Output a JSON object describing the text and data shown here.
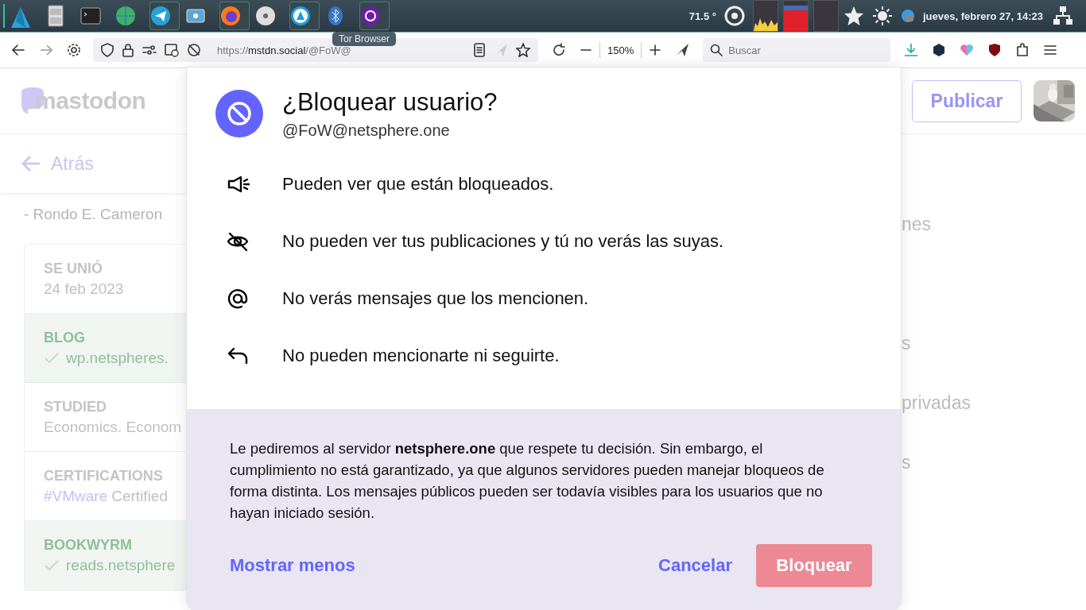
{
  "taskbar": {
    "tooltip": "Tor Browser",
    "temperature": "71.5 °",
    "clock": "jueves, febrero 27, 14:23"
  },
  "browser": {
    "url_scheme": "https://",
    "url_host": "mstdn.social",
    "url_path": "/@FoW@",
    "zoom": "150%",
    "search": {
      "placeholder": "Buscar"
    }
  },
  "site": {
    "logo": "mastodon",
    "back": "Atrás",
    "quote_author": "- Rondo E. Cameron",
    "fields": [
      {
        "label": "SE UNIÓ",
        "value": "24 feb 2023",
        "verified": false
      },
      {
        "label": "BLOG",
        "value": "wp.netspheres.",
        "verified": true
      },
      {
        "label": "STUDIED",
        "value": "Economics. Econom",
        "verified": false
      },
      {
        "label": "CERTIFICATIONS",
        "hashtag": "#VMware",
        "value": "Certified",
        "verified": false
      },
      {
        "label": "BOOKWYRM",
        "value": "reads.netsphere",
        "verified": true
      }
    ],
    "publish": "Publicar",
    "menu_items": [
      "nes",
      "s",
      "privadas",
      "s"
    ]
  },
  "dialog": {
    "title": "¿Bloquear usuario?",
    "handle": "@FoW@netsphere.one",
    "consequences": [
      {
        "kind": "megaphone",
        "text": "Pueden ver que están bloqueados."
      },
      {
        "kind": "eye-off",
        "text": "No pueden ver tus publicaciones y tú no verás las suyas."
      },
      {
        "kind": "at",
        "text": "No verás mensajes que los mencionen."
      },
      {
        "kind": "reply",
        "text": "No pueden mencionarte ni seguirte."
      }
    ],
    "note": "Le pediremos al servidor **netsphere.one** que respete tu decisión. Sin embargo, el cumplimiento no está garantizado, ya que algunos servidores pueden manejar bloqueos de forma distinta. Los mensajes públicos pueden ser todavía visibles para los usuarios que no hayan iniciado sesión.",
    "buttons": [
      {
        "kind": "link",
        "label": "Mostrar menos"
      },
      {
        "kind": "secondary",
        "label": "Cancelar"
      },
      {
        "kind": "danger",
        "label": "Bloquear"
      }
    ]
  }
}
